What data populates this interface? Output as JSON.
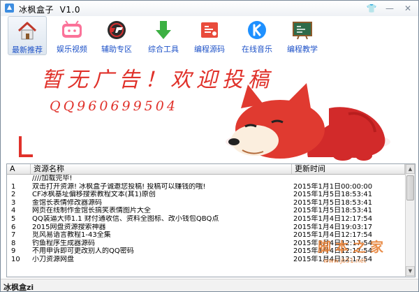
{
  "window": {
    "title": "冰枫盒子",
    "version": "V1.0",
    "controls": {
      "skin": "👕",
      "min": "—",
      "close": "✕"
    }
  },
  "toolbar": {
    "items": [
      {
        "label": "最新推荐",
        "icon": "home-icon"
      },
      {
        "label": "娱乐视频",
        "icon": "bilibili-icon"
      },
      {
        "label": "辅助专区",
        "icon": "crossfire-icon"
      },
      {
        "label": "综合工具",
        "icon": "download-arrow-icon"
      },
      {
        "label": "编程源码",
        "icon": "code-book-icon"
      },
      {
        "label": "在线音乐",
        "icon": "kugou-music-icon"
      },
      {
        "label": "编程教学",
        "icon": "blackboard-icon"
      }
    ]
  },
  "banner": {
    "headline": "暂无广告！欢迎投稿",
    "qq": "QQ960699504"
  },
  "table": {
    "columns": [
      "A",
      "资源名称",
      "更新时间"
    ],
    "rows": [
      {
        "idx": "",
        "name": "////加载完毕!",
        "time": ""
      },
      {
        "idx": "1",
        "name": "双击打开资源! 冰枫盒子诚邀您投稿! 投稿可以赚钱的哦!",
        "time": "2015年1月1日00:00:00"
      },
      {
        "idx": "2",
        "name": "CF冰枫基址偏移搜索教程文本(其1)原创",
        "time": "2015年1月5日18:53:41"
      },
      {
        "idx": "3",
        "name": "金馆长表情修改器源码",
        "time": "2015年1月5日18:53:41"
      },
      {
        "idx": "4",
        "name": "网页在线制作金馆长搞笑表情图片大全",
        "time": "2015年1月5日18:53:41"
      },
      {
        "idx": "5",
        "name": "QQ装逼大师1.1 财付通收信、资料全图标、改小钱包QBQ点",
        "time": "2015年1月4日12:17:54"
      },
      {
        "idx": "6",
        "name": "2015网盘资源搜索神器",
        "time": "2015年1月4日19:03:17"
      },
      {
        "idx": "7",
        "name": "觅风易语言教程1-43全集",
        "time": "2015年1月4日12:17:54"
      },
      {
        "idx": "8",
        "name": "钓鱼程序生成器源码",
        "time": "2015年1月4日12:17:54"
      },
      {
        "idx": "9",
        "name": "不用申诉即可更改别人的QQ密码",
        "time": "2015年1月4日12:17:54"
      },
      {
        "idx": "10",
        "name": "小刀资源网盘",
        "time": "2015年1月4日12:17:54"
      }
    ]
  },
  "scrollbar": {
    "up": "▲",
    "down": "▼"
  },
  "status": "冰枫盒zi",
  "watermark": {
    "brand": "脚本之家",
    "url": "www.jb51.net"
  },
  "colors": {
    "accent": "#1e52c8",
    "banner": "#e0312a"
  }
}
